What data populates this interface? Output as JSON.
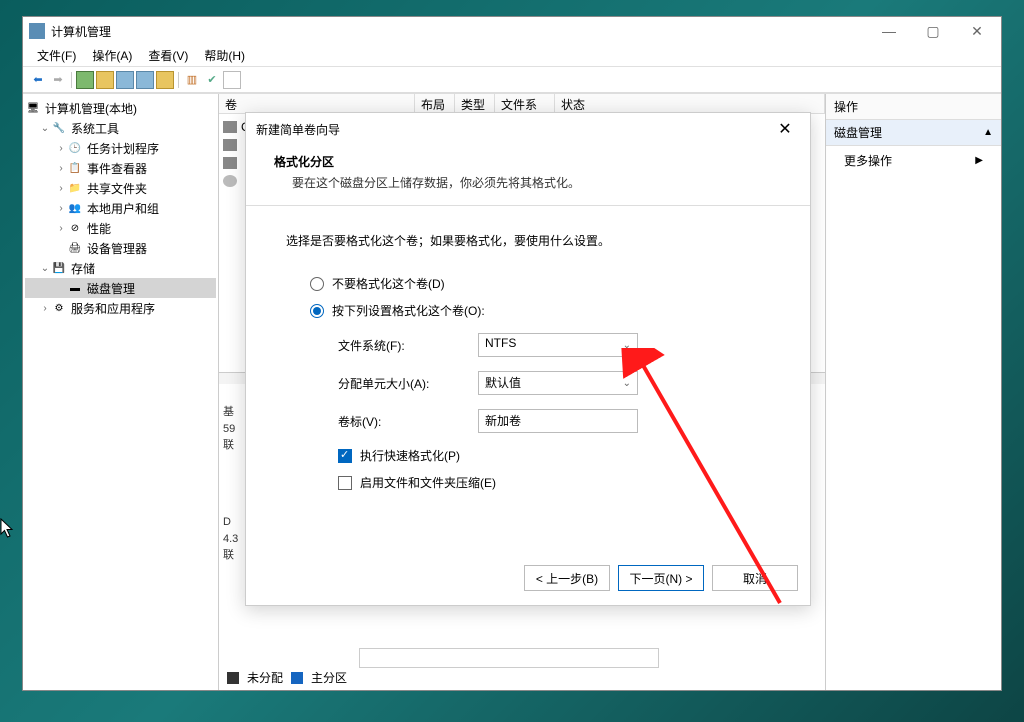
{
  "window": {
    "title": "计算机管理"
  },
  "menu": {
    "file": "文件(F)",
    "action": "操作(A)",
    "view": "查看(V)",
    "help": "帮助(H)"
  },
  "tree": {
    "root": "计算机管理(本地)",
    "system_tools": "系统工具",
    "task_scheduler": "任务计划程序",
    "event_viewer": "事件查看器",
    "shared_folders": "共享文件夹",
    "local_users": "本地用户和组",
    "performance": "性能",
    "device_manager": "设备管理器",
    "storage": "存储",
    "disk_management": "磁盘管理",
    "services_apps": "服务和应用程序"
  },
  "list_headers": {
    "volume": "卷",
    "layout": "布局",
    "type": "类型",
    "fs": "文件系统",
    "status": "状态"
  },
  "list_items": {
    "item0": "C",
    "item1": "",
    "item2": ""
  },
  "actions": {
    "title": "操作",
    "disk_mgmt": "磁盘管理",
    "more": "更多操作"
  },
  "legend": {
    "unallocated": "未分配",
    "primary": "主分区"
  },
  "bottom_snippets": {
    "s1": "基\n59\n联",
    "s2": "D\n4.3\n联"
  },
  "dialog": {
    "title": "新建简单卷向导",
    "heading": "格式化分区",
    "sub": "要在这个磁盘分区上储存数据，你必须先将其格式化。",
    "instruction": "选择是否要格式化这个卷；如果要格式化，要使用什么设置。",
    "radio_no": "不要格式化这个卷(D)",
    "radio_yes": "按下列设置格式化这个卷(O):",
    "fs_label": "文件系统(F):",
    "fs_value": "NTFS",
    "alloc_label": "分配单元大小(A):",
    "alloc_value": "默认值",
    "vol_label": "卷标(V):",
    "vol_value": "新加卷",
    "quick_format": "执行快速格式化(P)",
    "compress": "启用文件和文件夹压缩(E)",
    "back": "< 上一步(B)",
    "next": "下一页(N) >",
    "cancel": "取消"
  }
}
